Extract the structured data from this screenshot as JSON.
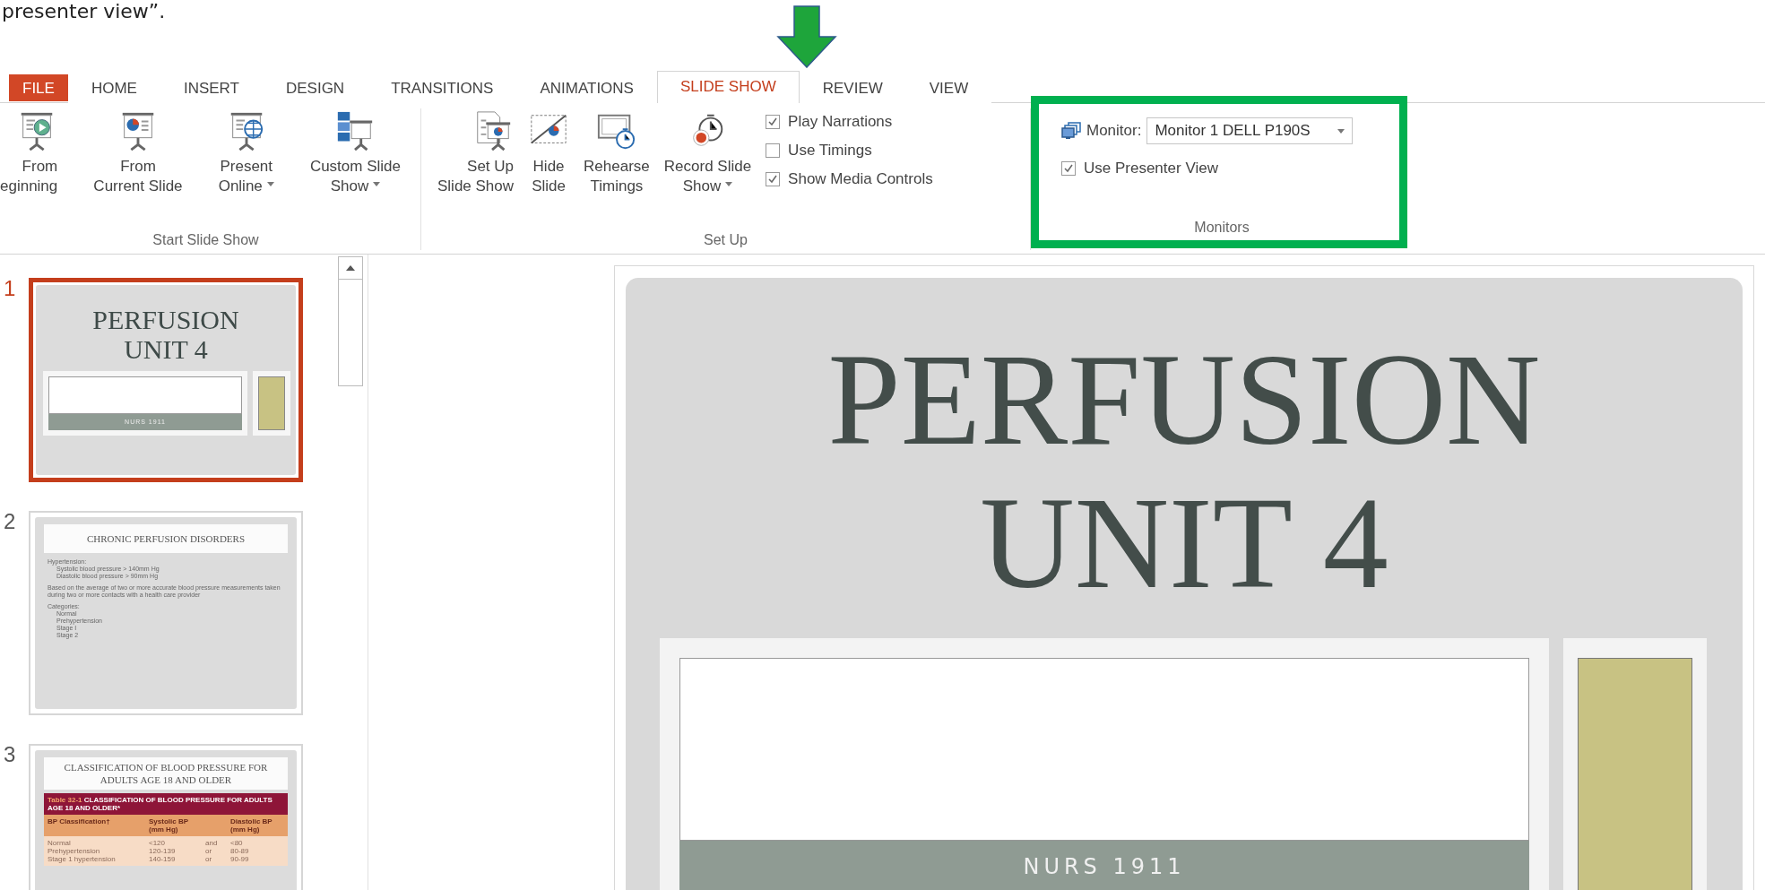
{
  "caption": "presenter view”.",
  "tabs": [
    {
      "label": "FILE",
      "kind": "file",
      "selected": false
    },
    {
      "label": "HOME",
      "kind": "tab",
      "selected": false
    },
    {
      "label": "INSERT",
      "kind": "tab",
      "selected": false
    },
    {
      "label": "DESIGN",
      "kind": "tab",
      "selected": false
    },
    {
      "label": "TRANSITIONS",
      "kind": "tab",
      "selected": false
    },
    {
      "label": "ANIMATIONS",
      "kind": "tab",
      "selected": false
    },
    {
      "label": "SLIDE SHOW",
      "kind": "tab",
      "selected": true
    },
    {
      "label": "REVIEW",
      "kind": "tab",
      "selected": false
    },
    {
      "label": "VIEW",
      "kind": "tab",
      "selected": false
    }
  ],
  "ribbon": {
    "groups": [
      {
        "label": "Start Slide Show",
        "kind": "buttons",
        "buttons": [
          {
            "kind": "play",
            "lines": [
              "From",
              "eginning"
            ]
          },
          {
            "kind": "pie",
            "lines": [
              "From",
              "Current Slide"
            ]
          },
          {
            "kind": "globe",
            "lines": [
              "Present",
              "Online"
            ],
            "dropdown": true
          },
          {
            "kind": "custom",
            "lines": [
              "Custom Slide",
              "Show"
            ],
            "dropdown": true
          }
        ]
      },
      {
        "label": "Set Up",
        "kind": "buttons",
        "buttons": [
          {
            "kind": "setup",
            "lines": [
              "Set Up",
              "Slide Show"
            ]
          },
          {
            "kind": "hide",
            "lines": [
              "Hide",
              "Slide"
            ]
          },
          {
            "kind": "rehearse",
            "lines": [
              "Rehearse",
              "Timings"
            ]
          },
          {
            "kind": "record",
            "lines": [
              "Record Slide",
              "Show"
            ],
            "dropdown": true
          }
        ],
        "checkboxes": [
          {
            "label": "Play Narrations",
            "checked": true
          },
          {
            "label": "Use Timings",
            "checked": false
          },
          {
            "label": "Show Media Controls",
            "checked": true
          }
        ]
      },
      {
        "label": "Monitors",
        "kind": "monitors",
        "highlighted": true,
        "monitor_label": "Monitor:",
        "monitor_value": "Monitor 1 DELL P190S",
        "checkboxes": [
          {
            "label": "Use Presenter View",
            "checked": true
          }
        ]
      }
    ]
  },
  "slides": [
    {
      "number": "1",
      "selected": true,
      "kind": "title",
      "title_lines": [
        "PERFUSION",
        "UNIT 4"
      ],
      "subtitle": "NURS 1911"
    },
    {
      "number": "2",
      "selected": false,
      "kind": "bullets",
      "title": "CHRONIC PERFUSION DISORDERS",
      "bullets": [
        {
          "text": "Hypertension:",
          "children": [
            {
              "text": "Systolic blood pressure > 140mm Hg"
            },
            {
              "text": "Diastolic blood pressure > 90mm Hg"
            }
          ]
        },
        {
          "text": "Based on the average of two or more accurate blood pressure measurements taken during two or more contacts with a health care provider"
        },
        {
          "text": "Categories:",
          "children": [
            {
              "text": "Normal"
            },
            {
              "text": "Prehypertension"
            },
            {
              "text": "Stage I"
            },
            {
              "text": "Stage 2"
            }
          ]
        }
      ]
    },
    {
      "number": "3",
      "selected": false,
      "kind": "table",
      "title": "CLASSIFICATION OF BLOOD PRESSURE FOR ADULTS AGE 18 AND OLDER",
      "table_label": "Table 32-1",
      "table_caption": "CLASSIFICATION OF BLOOD PRESSURE FOR ADULTS AGE 18 AND OLDER*",
      "columns": [
        "BP Classification†",
        "Systolic BP (mm Hg)",
        "",
        "Diastolic BP (mm Hg)"
      ],
      "rows": [
        [
          "Normal",
          "<120",
          "and",
          "<80"
        ],
        [
          "Prehypertension",
          "120-139",
          "or",
          "80-89"
        ],
        [
          "Stage 1 hypertension",
          "140-159",
          "or",
          "90-99"
        ]
      ]
    }
  ],
  "slide": {
    "title_lines": [
      "PERFUSION",
      "UNIT 4"
    ],
    "subtitle": "NURS 1911"
  }
}
